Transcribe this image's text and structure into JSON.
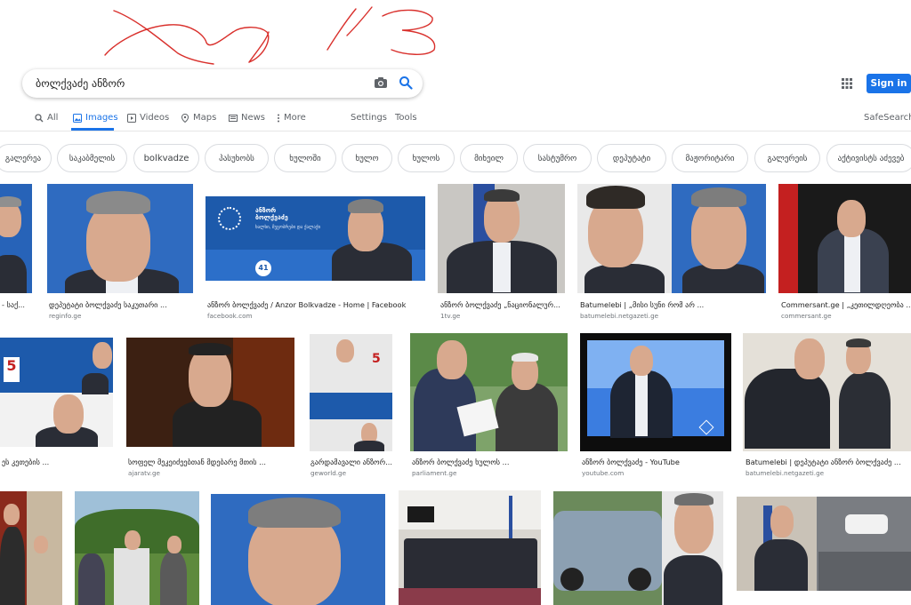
{
  "search": {
    "query": "ბოლქვაძე ანზორ"
  },
  "header": {
    "signin_label": "Sign in",
    "apps_icon": "apps-grid-icon"
  },
  "tabs": [
    {
      "label": "All",
      "icon": "search-icon"
    },
    {
      "label": "Images",
      "icon": "image-icon",
      "active": true
    },
    {
      "label": "Videos",
      "icon": "play-icon"
    },
    {
      "label": "Maps",
      "icon": "map-icon"
    },
    {
      "label": "News",
      "icon": "news-icon"
    },
    {
      "label": "More",
      "icon": "more-dots-icon"
    },
    {
      "label": "Settings"
    },
    {
      "label": "Tools"
    }
  ],
  "safesearch_label": "SafeSearch",
  "chips": [
    "გალერეა",
    "საკაბმელის",
    "bolkvadze",
    "პასუხობს",
    "ხულოში",
    "ხულო",
    "ხულოს",
    "მიხეილ",
    "სასტუმრო",
    "დეპუტატი",
    "მაჟორიტარი",
    "გალერეის",
    "აქტივისტს აძევებ"
  ],
  "results": [
    {
      "caption": "- საქ...",
      "source": ""
    },
    {
      "caption": "დეპუტატი ბოლქვაძე საკუთარი ...",
      "source": "reginfo.ge"
    },
    {
      "caption": "ანზორ ბოლქვაძე / Anzor Bolkvadze - Home | Facebook",
      "source": "facebook.com"
    },
    {
      "caption": "ანზორ ბოლქვაძე „ნაციონალურ...",
      "source": "1tv.ge"
    },
    {
      "caption": "Batumelebi | „მისი სუნი რომ არ ...",
      "source": "batumelebi.netgazeti.ge"
    },
    {
      "caption": "Commersant.ge | „კეთილდღეობა ...",
      "source": "commersant.ge"
    },
    {
      "caption": "ეს კეთების ...",
      "source": ""
    },
    {
      "caption": "სოფელ მეკეიძეებთან მდებარე მთის ...",
      "source": "ajaratv.ge"
    },
    {
      "caption": "გარდამავალი ანზორ...",
      "source": "geworld.ge"
    },
    {
      "caption": "ანზორ ბოლქვაძე ხულოს ...",
      "source": "parliament.ge"
    },
    {
      "caption": "ანზორ ბოლქვაძე - YouTube",
      "source": "youtube.com"
    },
    {
      "caption": "Batumelebi | დეპუტატი ანზორ ბოლქვაძე ...",
      "source": "batumelebi.netgazeti.ge"
    }
  ],
  "banner": {
    "party_name": "ანზორ ბოლქვაძე",
    "party_text": "ხალხი, მეგობრები და ქალაქი",
    "number": "41"
  },
  "colors": {
    "accent": "#1a73e8",
    "scribble": "#d9302c",
    "banner_blue": "#1d5aab"
  }
}
